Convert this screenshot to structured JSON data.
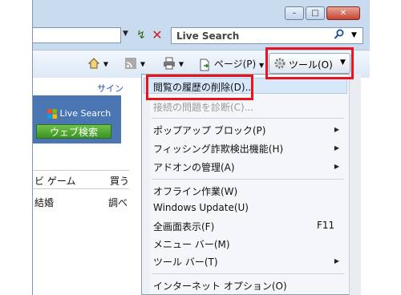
{
  "title_bar": {
    "minimize": "–",
    "maximize": "□",
    "close": "✕"
  },
  "address_bar": {
    "dropdown": "▼",
    "refresh": "↯",
    "stop": "✕"
  },
  "search": {
    "text": "Live Search",
    "icon": "search-icon",
    "dropdown": "▼"
  },
  "command_bar": {
    "home_arrow": "▼",
    "feeds_arrow": "▼",
    "print_arrow": "▼",
    "page_label": "ページ(P)",
    "page_arrow": "▼",
    "tools_label": "ツール(O)",
    "tools_arrow": "▼"
  },
  "page": {
    "signin": "サイン",
    "live_search_logo": "Live Search",
    "web_search_button": "ウェブ検索",
    "links_row1_left": "ビ ゲーム",
    "links_row1_right": "買う",
    "links_row2_left": "結婚",
    "links_row2_right": "調べ"
  },
  "menu": {
    "items": [
      {
        "label": "閲覧の履歴の削除(D)...",
        "state": "highlighted"
      },
      {
        "label": "接続の問題を診断(C)...",
        "state": "disabled"
      },
      {
        "label": "ポップアップ ブロック(P)",
        "submenu": true
      },
      {
        "label": "フィッシング詐欺検出機能(H)",
        "submenu": true
      },
      {
        "label": "アドオンの管理(A)",
        "submenu": true
      },
      {
        "label": "オフライン作業(W)"
      },
      {
        "label": "Windows Update(U)"
      },
      {
        "label": "全画面表示(F)",
        "shortcut": "F11"
      },
      {
        "label": "メニュー バー(M)"
      },
      {
        "label": "ツール バー(T)",
        "submenu": true
      },
      {
        "label": "インターネット オプション(O)"
      }
    ],
    "submenu_arrow": "▶"
  },
  "colors": {
    "highlight_box": "#e8141e",
    "hover": "#d7e8fb",
    "accent": "#2255aa"
  }
}
